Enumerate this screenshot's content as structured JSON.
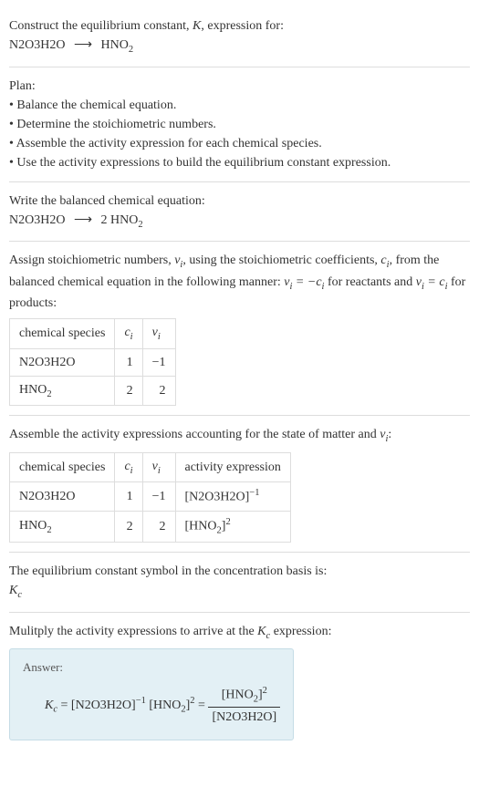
{
  "intro": {
    "line1_prefix": "Construct the equilibrium constant, ",
    "line1_K": "K",
    "line1_suffix": ", expression for:",
    "reactant": "N2O3H2O",
    "product": "HNO"
  },
  "plan": {
    "heading": "Plan:",
    "b1": "• Balance the chemical equation.",
    "b2": "• Determine the stoichiometric numbers.",
    "b3": "• Assemble the activity expression for each chemical species.",
    "b4": "• Use the activity expressions to build the equilibrium constant expression."
  },
  "balanced": {
    "text": "Write the balanced chemical equation:",
    "lhs": "N2O3H2O",
    "coef": "2",
    "rhs": "HNO"
  },
  "stoich": {
    "text1": "Assign stoichiometric numbers, ",
    "nu": "ν",
    "text2": ", using the stoichiometric coefficients, ",
    "c": "c",
    "text3": ", from the balanced chemical equation in the following manner: ",
    "rel1a": "ν",
    "rel1b": " = −c",
    "text4": " for reactants and ",
    "rel2a": "ν",
    "rel2b": " = c",
    "text5": " for products:",
    "headers": {
      "h1": "chemical species",
      "h2": "c",
      "h3": "ν"
    },
    "row1": {
      "sp": "N2O3H2O",
      "c": "1",
      "nu": "−1"
    },
    "row2": {
      "sp": "HNO",
      "c": "2",
      "nu": "2"
    }
  },
  "activity": {
    "text1": "Assemble the activity expressions accounting for the state of matter and ",
    "nu": "ν",
    "text2": ":",
    "headers": {
      "h1": "chemical species",
      "h2": "c",
      "h3": "ν",
      "h4": "activity expression"
    },
    "row1": {
      "sp": "N2O3H2O",
      "c": "1",
      "nu": "−1",
      "exp": "−1"
    },
    "row2": {
      "sp": "HNO",
      "c": "2",
      "nu": "2",
      "exp": "2"
    }
  },
  "symbol": {
    "text": "The equilibrium constant symbol in the concentration basis is:",
    "Kc": "K"
  },
  "final": {
    "text": "Mulitply the activity expressions to arrive at the ",
    "Kc": "K",
    "text2": " expression:",
    "answer_label": "Answer:",
    "lhs": "K",
    "term1": "[N2O3H2O]",
    "exp1": "−1",
    "term2": "[HNO",
    "term2b": "]",
    "exp2": "2",
    "frac_num": "[HNO",
    "frac_num_b": "]",
    "frac_num_exp": "2",
    "frac_den": "[N2O3H2O]"
  }
}
